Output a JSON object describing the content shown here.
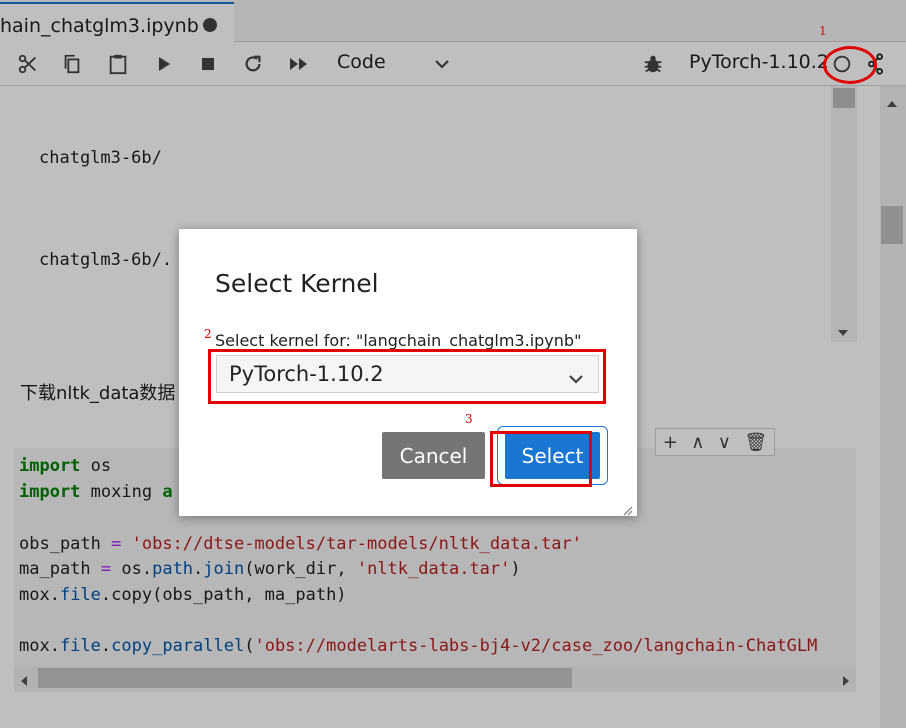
{
  "tab": {
    "title": "hain_chatglm3.ipynb"
  },
  "toolbar": {
    "cell_type": "Code",
    "kernel_name": "PyTorch-1.10.2",
    "icons": [
      "cut-icon",
      "copy-icon",
      "paste-icon",
      "run-icon",
      "stop-icon",
      "restart-icon",
      "fast-forward-icon",
      "chevron-down-icon",
      "bug-icon",
      "kernel-status-icon",
      "share-icon"
    ]
  },
  "output": {
    "lines": [
      "chatglm3-6b/",
      "chatglm3-6b/."
    ]
  },
  "markdown": {
    "text": "下载nltk_data数据"
  },
  "code": {
    "l1_kw": "import",
    "l1_rest": " os",
    "l2_kw": "import",
    "l2_rest": " moxing ",
    "l2_tail": "a",
    "l3_a": "obs_path ",
    "l3_op": "=",
    "l3_str": " 'obs://dtse-models/tar-models/nltk_data.tar'",
    "l4_a": "ma_path ",
    "l4_op": "=",
    "l4_b": " os.",
    "l4_attr": "path",
    "l4_c": ".",
    "l4_attr2": "join",
    "l4_d": "(work_dir, ",
    "l4_str": "'nltk_data.tar'",
    "l4_e": ")",
    "l5_a": "mox.",
    "l5_attr": "file",
    "l5_b": ".copy(obs_path, ma_path)",
    "l6_a": "mox.",
    "l6_attr": "file",
    "l6_b": ".",
    "l6_attr2": "copy_parallel",
    "l6_c": "(",
    "l6_str": "'obs://modelarts-labs-bj4-v2/case_zoo/langchain-ChatGLM"
  },
  "cell_actions": [
    "+",
    "∧",
    "∨",
    "🗑"
  ],
  "dialog": {
    "title": "Select Kernel",
    "label": "Select kernel for: \"langchain_chatglm3.ipynb\"",
    "selected_kernel": "PyTorch-1.10.2",
    "cancel_label": "Cancel",
    "select_label": "Select"
  },
  "annotations": {
    "n1": "1",
    "n2": "2",
    "n3": "3",
    "color": "#e00000"
  },
  "colors": {
    "accent": "#1976d2",
    "cancel": "#757575"
  }
}
